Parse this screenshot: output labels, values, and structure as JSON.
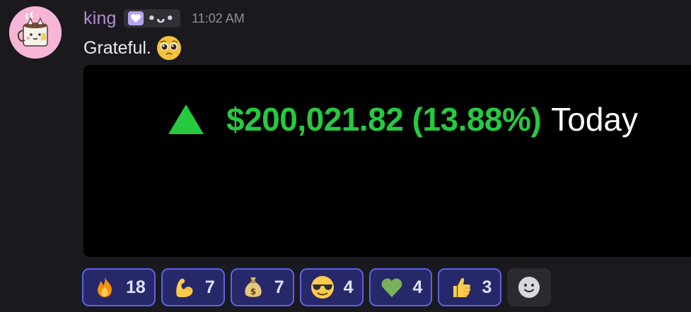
{
  "message": {
    "username": "king",
    "tag_text": "•ᴗ•",
    "timestamp": "11:02 AM",
    "content": "Grateful.",
    "content_emoji": "pleading-face-icon"
  },
  "embed": {
    "direction": "up",
    "gain_text": "$200,021.82 (13.88%)",
    "period_label": "Today"
  },
  "reactions": [
    {
      "emoji": "fire-icon",
      "count": "18"
    },
    {
      "emoji": "flexed-biceps-icon",
      "count": "7"
    },
    {
      "emoji": "money-bag-icon",
      "count": "7"
    },
    {
      "emoji": "sunglasses-face-icon",
      "count": "4"
    },
    {
      "emoji": "green-heart-icon",
      "count": "4"
    },
    {
      "emoji": "thumbs-up-icon",
      "count": "3"
    }
  ],
  "add_reaction_icon": "add-reaction-icon",
  "colors": {
    "background": "#1a1a1e",
    "username": "#b48ad6",
    "gain": "#27c93f",
    "reaction_bg": "#26286a",
    "reaction_border": "#5a64e6"
  }
}
